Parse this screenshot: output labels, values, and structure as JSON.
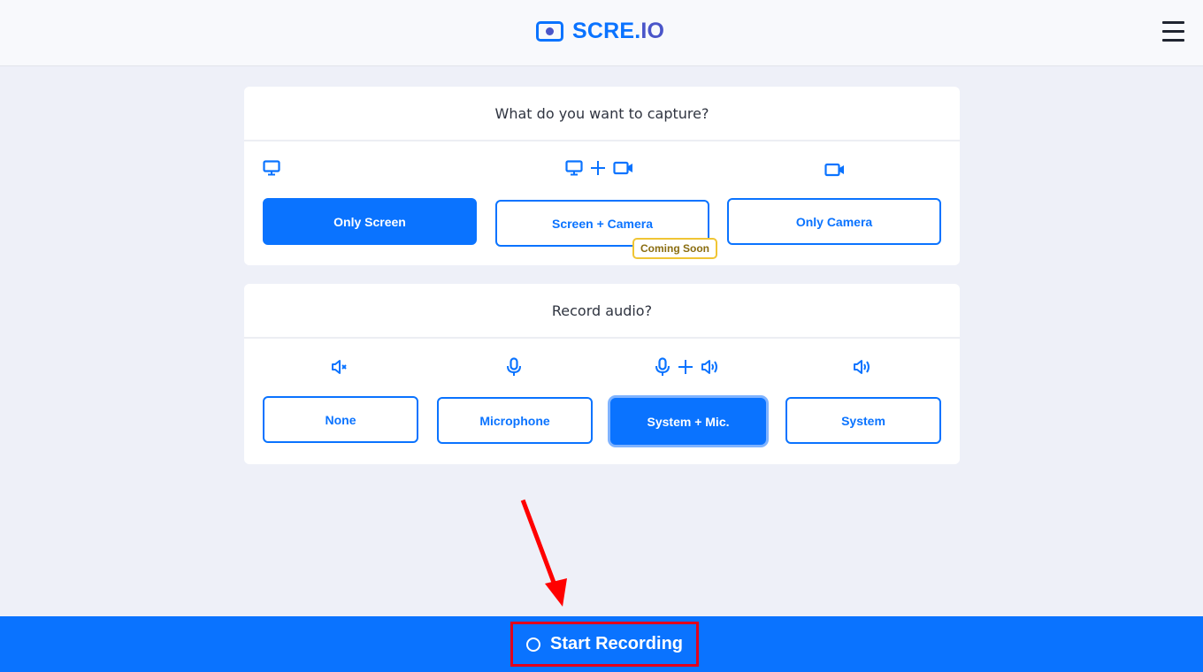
{
  "header": {
    "logo_main": "SCRE.",
    "logo_suffix": "IO",
    "menu_icon": "hamburger-menu-icon"
  },
  "capture": {
    "title": "What do you want to capture?",
    "options": [
      {
        "label": "Only Screen",
        "icons": [
          "monitor-icon"
        ],
        "selected": true
      },
      {
        "label": "Screen + Camera",
        "icons": [
          "monitor-icon",
          "plus-icon",
          "video-camera-icon"
        ],
        "selected": false,
        "badge": "Coming Soon"
      },
      {
        "label": "Only Camera",
        "icons": [
          "video-camera-icon"
        ],
        "selected": false
      }
    ]
  },
  "audio": {
    "title": "Record audio?",
    "options": [
      {
        "label": "None",
        "icons": [
          "speaker-muted-icon"
        ],
        "selected": false
      },
      {
        "label": "Microphone",
        "icons": [
          "microphone-icon"
        ],
        "selected": false
      },
      {
        "label": "System + Mic.",
        "icons": [
          "microphone-icon",
          "plus-icon",
          "speaker-icon"
        ],
        "selected": true
      },
      {
        "label": "System",
        "icons": [
          "speaker-icon"
        ],
        "selected": false
      }
    ]
  },
  "footer": {
    "start_label": "Start Recording",
    "start_icon": "record-circle-icon"
  },
  "colors": {
    "accent": "#0a73ff",
    "logo_secondary": "#4a55c9",
    "badge_border": "#f0c534",
    "annotation_red": "#e3001b",
    "background": "#eef0f8"
  }
}
